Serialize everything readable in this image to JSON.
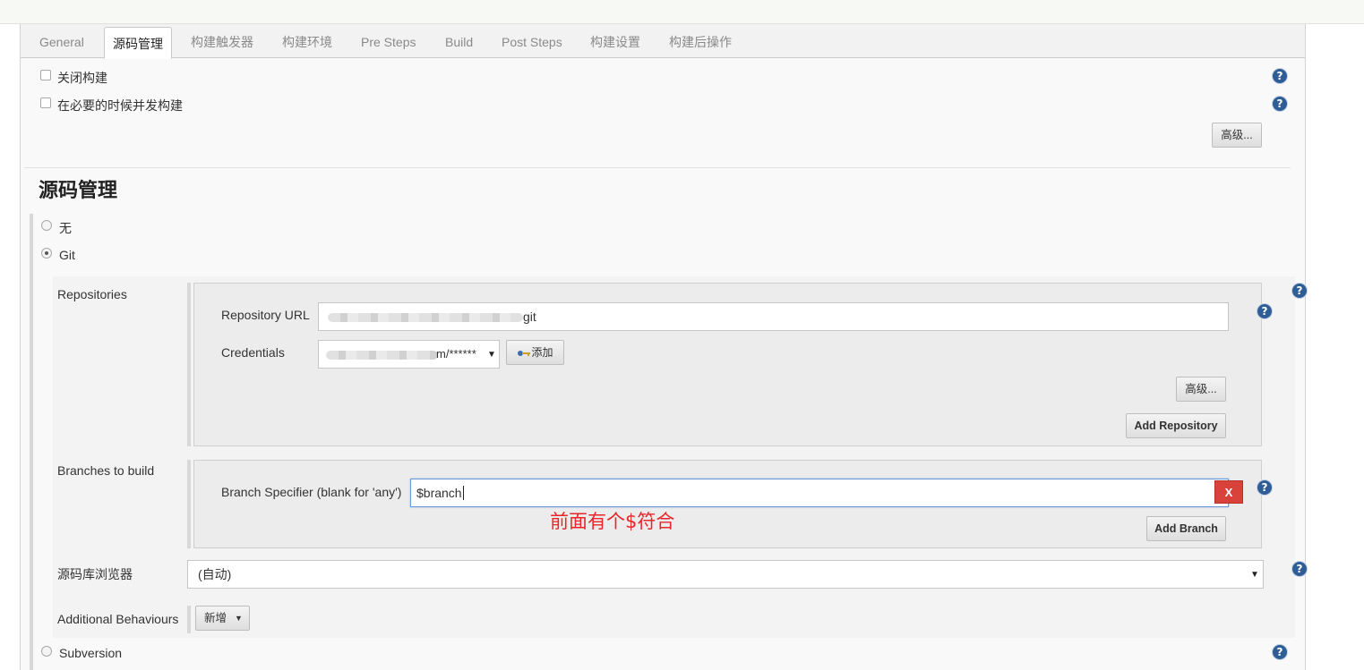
{
  "tabs": [
    {
      "label": "General"
    },
    {
      "label": "源码管理"
    },
    {
      "label": "构建触发器"
    },
    {
      "label": "构建环境"
    },
    {
      "label": "Pre Steps"
    },
    {
      "label": "Build"
    },
    {
      "label": "Post Steps"
    },
    {
      "label": "构建设置"
    },
    {
      "label": "构建后操作"
    }
  ],
  "options": {
    "disable_build": "关闭构建",
    "concurrent_build": "在必要的时候并发构建",
    "advanced_label": "高级..."
  },
  "scm": {
    "title": "源码管理",
    "none_label": "无",
    "git_label": "Git",
    "subversion_label": "Subversion",
    "repositories_label": "Repositories",
    "repo_url_label": "Repository URL",
    "repo_url_suffix": "git",
    "credentials_label": "Credentials",
    "credentials_suffix": "m/******",
    "add_label": "添加",
    "repo_advanced_label": "高级...",
    "add_repository_label": "Add Repository",
    "branches_label": "Branches to build",
    "branch_specifier_label": "Branch Specifier (blank for 'any')",
    "branch_value": "$branch",
    "delete_label": "X",
    "add_branch_label": "Add Branch",
    "browser_label": "源码库浏览器",
    "browser_value": "(自动)",
    "behaviours_label": "Additional Behaviours",
    "add_new_label": "新增"
  },
  "annotation": {
    "text": "前面有个$符合",
    "color": "#e8262a"
  },
  "help_icon": "?"
}
